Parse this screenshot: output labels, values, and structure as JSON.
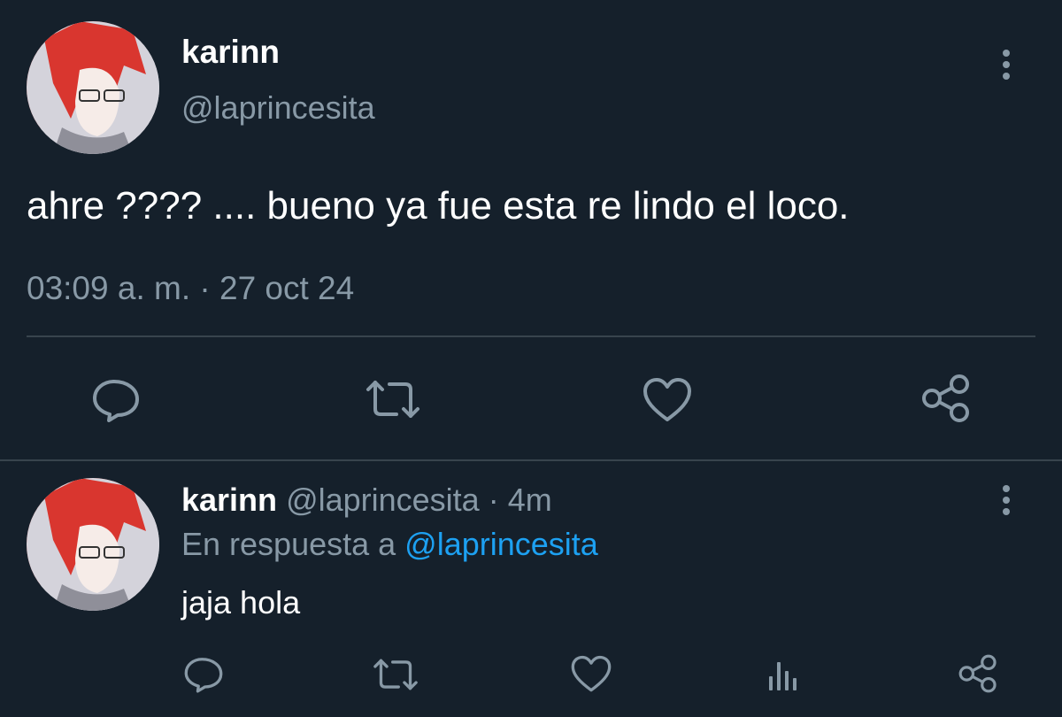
{
  "main_tweet": {
    "display_name": "karinn",
    "handle": "@laprincesita",
    "text": "ahre ???? .... bueno ya fue esta re lindo el loco.",
    "timestamp": "03:09 a. m. · 27 oct 24"
  },
  "actions": {
    "icons": [
      "reply-icon",
      "retweet-icon",
      "like-icon",
      "share-icon"
    ]
  },
  "reply": {
    "display_name": "karinn",
    "handle": "@laprincesita",
    "age": "· 4m",
    "reply_prefix": "En respuesta a",
    "reply_to": "@laprincesita",
    "text": "jaja hola",
    "icons": [
      "reply-icon",
      "retweet-icon",
      "like-icon",
      "analytics-icon",
      "share-icon"
    ]
  },
  "colors": {
    "background": "#15202b",
    "muted": "#8899a6",
    "link": "#1da1f2",
    "divider": "#38444d"
  }
}
